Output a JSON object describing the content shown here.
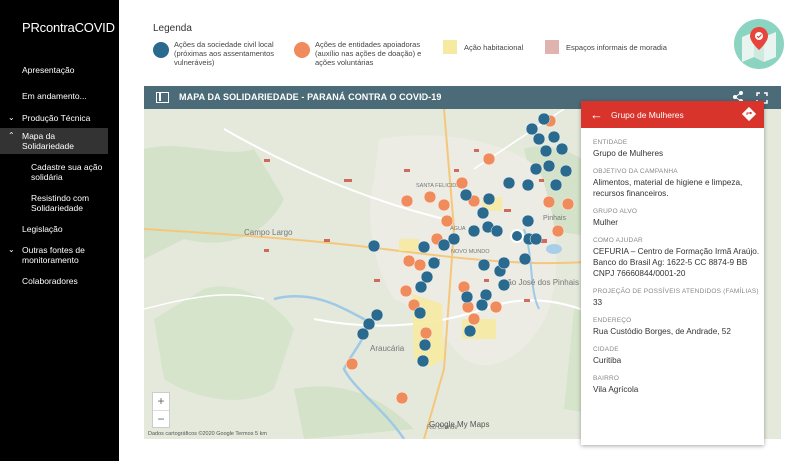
{
  "sidebar": {
    "brand": "PRcontraCOVID",
    "items": [
      {
        "label": "Apresentação"
      },
      {
        "label": "Em andamento..."
      },
      {
        "label": "Produção Técnica"
      },
      {
        "label": "Mapa da Solidariedade"
      },
      {
        "label": "Cadastre sua ação solidária"
      },
      {
        "label": "Resistindo com Solidariedade"
      },
      {
        "label": "Legislação"
      },
      {
        "label": "Outras fontes de monitoramento"
      },
      {
        "label": "Colaboradores"
      }
    ]
  },
  "legend": {
    "title": "Legenda",
    "items": [
      {
        "label": "Ações da sociedade civil local (próximas aos assentamentos vulneráveis)",
        "color": "#2a6a8e"
      },
      {
        "label": "Ações de entidades apoiadoras (auxílio nas ações de doação) e ações voluntárias",
        "color": "#f08c5c"
      },
      {
        "label": "Ação habitacional",
        "color": "#f6eaa0"
      },
      {
        "label": "Espaços informais de moradia",
        "color": "#e0b4ae"
      }
    ]
  },
  "map": {
    "title": "MAPA DA SOLIDARIEDADE - PARANÁ CONTRA O COVID-19",
    "credits": "Dados cartográficos ©2020 Google   Termos   5 km",
    "brand": "Google My Maps",
    "places": [
      "SANTA FELICIDADE",
      "ÁGUA",
      "Campo Largo",
      "Araucária",
      "São José dos Pinhais",
      "Pinhais",
      "NOVO MUNDO",
      "Rio Grande"
    ]
  },
  "panel": {
    "title": "Grupo de Mulheres",
    "fields": [
      {
        "label": "Entidade",
        "value": "Grupo de Mulheres"
      },
      {
        "label": "Objetivo da campanha",
        "value": "Alimentos, material de higiene e limpeza, recursos financeiros."
      },
      {
        "label": "Grupo alvo",
        "value": "Mulher"
      },
      {
        "label": "Como ajudar",
        "value": "CEFURIA – Centro de Formação Irmã Araújo. Banco do Brasil Ag: 1622-5 CC 8874-9 BB CNPJ 76660844/0001-20"
      },
      {
        "label": "Projeção de possíveis atendidos (famílias)",
        "value": "33"
      },
      {
        "label": "Endereço",
        "value": "Rua Custódio Borges, de Andrade, 52"
      },
      {
        "label": "Cidade",
        "value": "Curitiba"
      },
      {
        "label": "Bairro",
        "value": "Vila Agrícola"
      }
    ]
  },
  "colors": {
    "accent_red": "#d9342b",
    "header_slate": "#4b6b78",
    "marker_blue": "#2a6a8e",
    "marker_orange": "#f08c5c"
  }
}
